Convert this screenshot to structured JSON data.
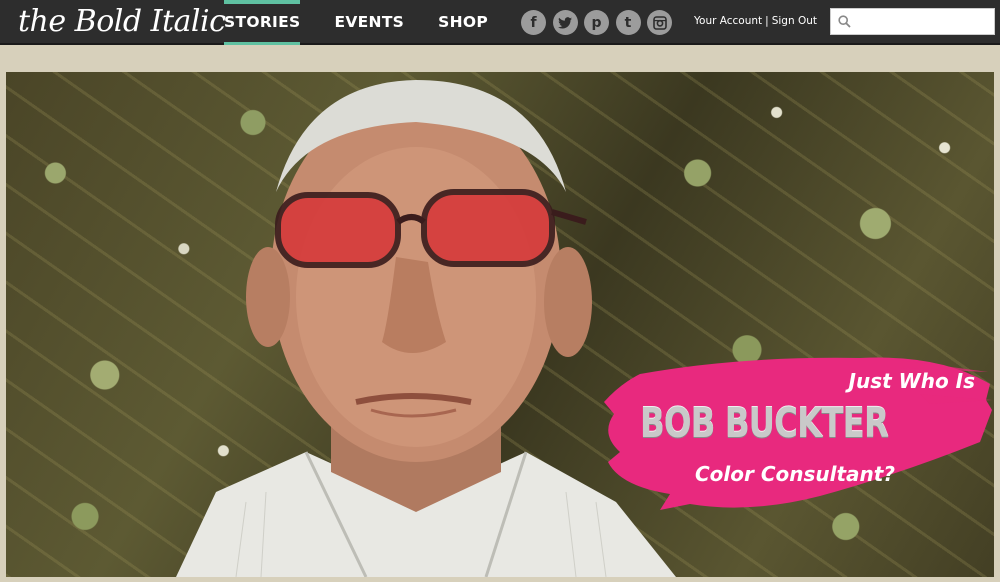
{
  "site": {
    "logo_text": "the Bold Italic"
  },
  "nav": {
    "items": [
      {
        "label": "STORIES",
        "active": true
      },
      {
        "label": "EVENTS",
        "active": false
      },
      {
        "label": "SHOP",
        "active": false
      }
    ]
  },
  "social": [
    {
      "icon": "facebook-icon",
      "glyph": "f"
    },
    {
      "icon": "twitter-icon",
      "glyph": ""
    },
    {
      "icon": "pinterest-icon",
      "glyph": "p"
    },
    {
      "icon": "tumblr-icon",
      "glyph": "t"
    },
    {
      "icon": "instagram-icon",
      "glyph": ""
    }
  ],
  "account": {
    "your_account": "Your Account",
    "separator": "|",
    "sign_out": "Sign Out"
  },
  "search": {
    "placeholder": "",
    "value": "",
    "icon": "search-icon"
  },
  "hero": {
    "headline_line1": "Just Who Is",
    "headline_name": "BOB BUCKTER",
    "headline_line3": "Color Consultant?",
    "banner_color": "#e8297e",
    "accent_color": "#5fc1a1"
  }
}
